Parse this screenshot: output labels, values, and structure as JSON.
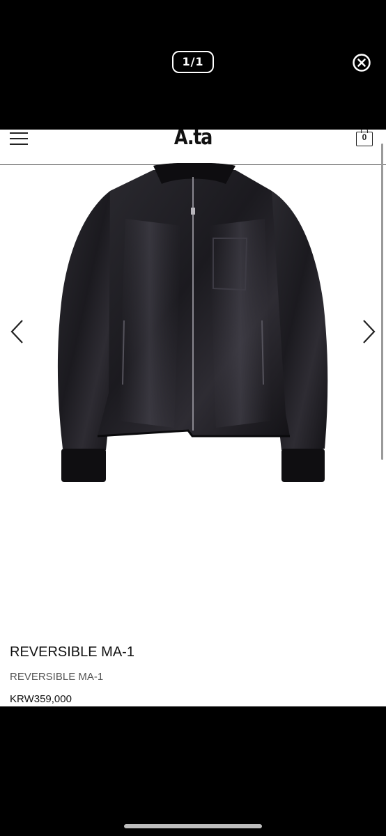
{
  "viewer": {
    "counter": "1/1"
  },
  "header": {
    "logo": "A.ta",
    "cart_count": "0"
  },
  "product": {
    "name": "REVERSIBLE MA-1",
    "subtitle": "REVERSIBLE MA-1",
    "price": "KRW359,000"
  },
  "icons": {
    "close": "close-icon",
    "menu": "hamburger-menu-icon",
    "cart": "shopping-bag-icon",
    "prev": "chevron-left-icon",
    "next": "chevron-right-icon"
  },
  "colors": {
    "viewer_background": "#000000",
    "page_background": "#ffffff",
    "text": "#111111",
    "secondary_text": "#555555"
  }
}
